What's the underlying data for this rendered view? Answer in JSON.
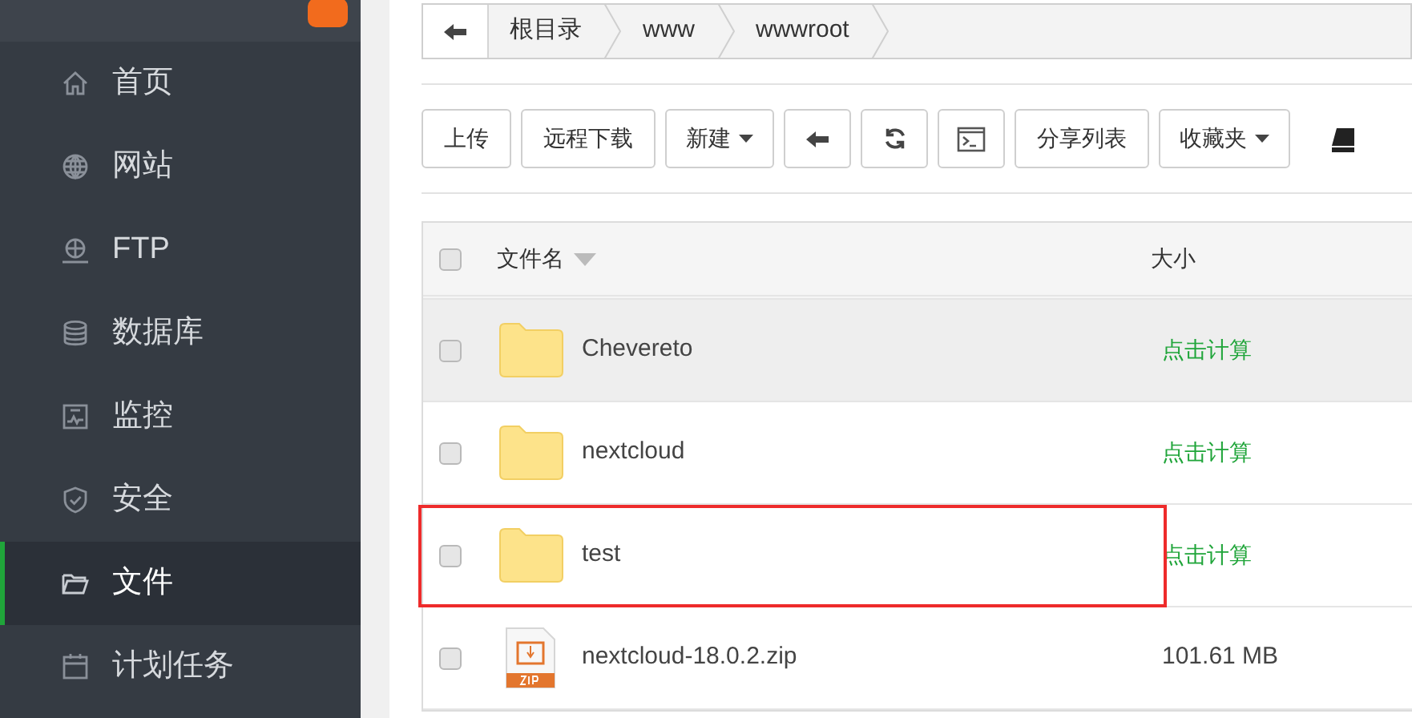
{
  "sidebar": {
    "items": [
      {
        "label": "首页",
        "selected": false
      },
      {
        "label": "网站",
        "selected": false
      },
      {
        "label": "FTP",
        "selected": false
      },
      {
        "label": "数据库",
        "selected": false
      },
      {
        "label": "监控",
        "selected": false
      },
      {
        "label": "安全",
        "selected": false
      },
      {
        "label": "文件",
        "selected": true
      },
      {
        "label": "计划任务",
        "selected": false
      }
    ]
  },
  "breadcrumb": [
    "根目录",
    "www",
    "wwwroot"
  ],
  "toolbar": [
    {
      "kind": "text",
      "label": "上传"
    },
    {
      "kind": "text",
      "label": "远程下载"
    },
    {
      "kind": "dropdown",
      "label": "新建"
    },
    {
      "kind": "back"
    },
    {
      "kind": "refresh"
    },
    {
      "kind": "terminal"
    },
    {
      "kind": "text",
      "label": "分享列表"
    },
    {
      "kind": "dropdown",
      "label": "收藏夹"
    }
  ],
  "table": {
    "columns": [
      "文件名",
      "大小"
    ],
    "all_checked": false,
    "rows": [
      {
        "name": "Chevereto",
        "kind": "folder",
        "size": "点击计算",
        "checked": false,
        "hovered": true,
        "highlighted": false
      },
      {
        "name": "nextcloud",
        "kind": "folder",
        "size": "点击计算",
        "checked": false,
        "hovered": false,
        "highlighted": false
      },
      {
        "name": "test",
        "kind": "folder",
        "size": "点击计算",
        "checked": false,
        "hovered": false,
        "highlighted": true
      },
      {
        "name": "nextcloud-18.0.2.zip",
        "kind": "zip",
        "size": "101.61 MB",
        "checked": false,
        "hovered": false,
        "highlighted": false
      }
    ]
  }
}
